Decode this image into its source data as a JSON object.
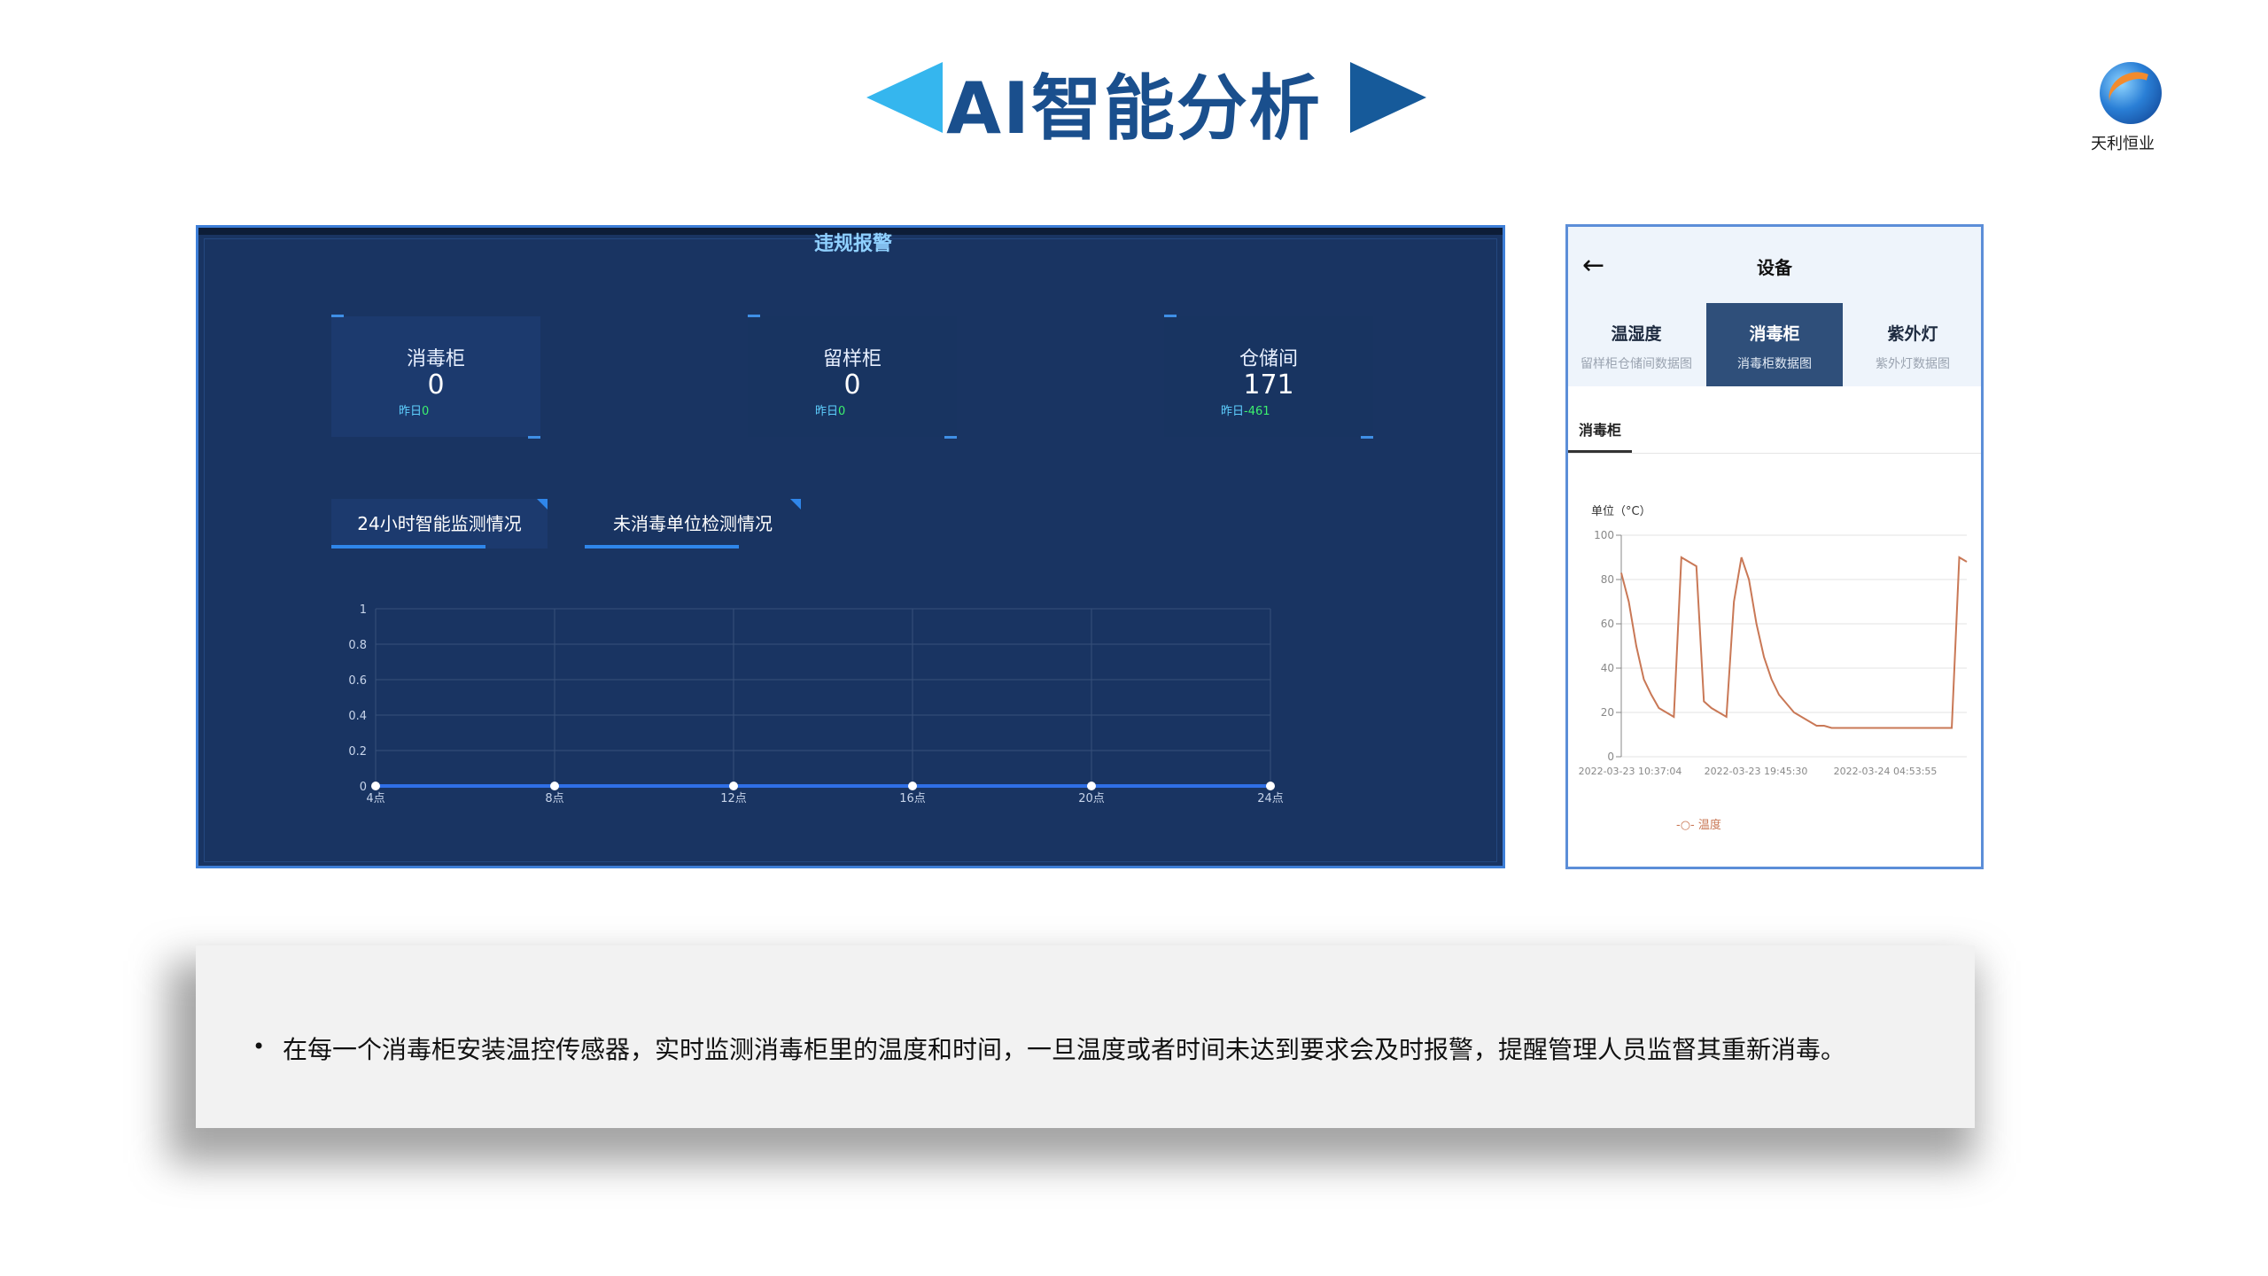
{
  "slide": {
    "title": "AI智能分析",
    "logo_text": "天利恒业",
    "note": "在每一个消毒柜安装温控传感器，实时监测消毒柜里的温度和时间，一旦温度或者时间未达到要求会及时报警，提醒管理人员监督其重新消毒。",
    "bullet": "•"
  },
  "dashboard": {
    "title": "违规报警",
    "stats": [
      {
        "label": "消毒柜",
        "value": "0",
        "sub_label": "昨日",
        "sub_value": "0"
      },
      {
        "label": "留样柜",
        "value": "0",
        "sub_label": "昨日",
        "sub_value": "0"
      },
      {
        "label": "仓储间",
        "value": "171",
        "sub_label": "昨日",
        "sub_value": "-461"
      }
    ],
    "tabs": [
      {
        "label": "24小时智能监测情况"
      },
      {
        "label": "未消毒单位检测情况"
      }
    ]
  },
  "phone": {
    "back_icon": "arrow-left-icon",
    "title": "设备",
    "tabs": [
      {
        "title": "温湿度",
        "sub": "留样柜仓储间数据图"
      },
      {
        "title": "消毒柜",
        "sub": "消毒柜数据图"
      },
      {
        "title": "紫外灯",
        "sub": "紫外灯数据图"
      }
    ],
    "segment": "消毒柜",
    "unit": "单位（°C）",
    "legend": "温度"
  },
  "chart_data": [
    {
      "type": "line",
      "x": [
        "4点",
        "8点",
        "12点",
        "16点",
        "20点",
        "24点"
      ],
      "yticks": [
        "0",
        "0.2",
        "0.4",
        "0.6",
        "0.8",
        "1"
      ],
      "ylim": [
        0,
        1
      ],
      "series": [
        {
          "values": [
            0,
            0,
            0,
            0,
            0,
            0
          ]
        }
      ],
      "colors": {
        "line": "#2f6fe6",
        "grid": "#36507a",
        "axis_text": "#c7d4ea"
      }
    },
    {
      "type": "line",
      "ylabel": "单位（°C）",
      "yticks": [
        "0",
        "20",
        "40",
        "60",
        "80",
        "100"
      ],
      "ylim": [
        0,
        100
      ],
      "xticks": [
        "2022-03-23 10:37:04",
        "2022-03-23 19:45:30",
        "2022-03-24 04:53:55"
      ],
      "series": [
        {
          "name": "温度",
          "values": [
            83,
            70,
            50,
            35,
            28,
            22,
            20,
            18,
            90,
            88,
            86,
            25,
            22,
            20,
            18,
            70,
            90,
            80,
            60,
            45,
            35,
            28,
            24,
            20,
            18,
            16,
            14,
            14,
            13,
            13,
            13,
            13,
            13,
            13,
            13,
            13,
            13,
            13,
            13,
            13,
            13,
            13,
            13,
            13,
            13,
            90,
            88
          ]
        }
      ],
      "colors": {
        "line": "#c97856"
      }
    }
  ]
}
